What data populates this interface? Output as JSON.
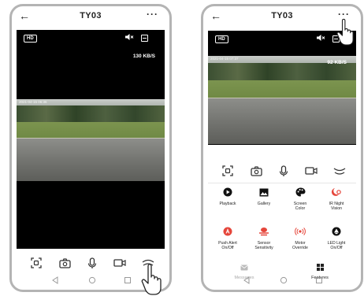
{
  "phones": [
    {
      "title": "TY03",
      "back_icon": "arrow-left-icon",
      "more_icon": "more-dots-icon",
      "video": {
        "quality_badge": "HD",
        "speed": "130 KB/S",
        "timestamp": "2021-04-15 06:36"
      },
      "controls": [
        "screenshot-icon",
        "camera-icon",
        "microphone-icon",
        "video-record-icon",
        "expand-icon"
      ]
    },
    {
      "title": "TY03",
      "back_icon": "arrow-left-icon",
      "more_icon": "more-dots-icon",
      "video": {
        "quality_badge": "HD",
        "speed": "92 KB/S",
        "timestamp": "2021-04-15 07:37"
      },
      "controls": [
        "screenshot-icon",
        "camera-icon",
        "microphone-icon",
        "video-record-icon",
        "expand-icon"
      ],
      "features": [
        {
          "label": "Playback",
          "icon": "play-icon",
          "color": "#111111"
        },
        {
          "label": "Gallery",
          "icon": "gallery-icon",
          "color": "#111111"
        },
        {
          "label": "Screen\nColor",
          "icon": "palette-icon",
          "color": "#111111"
        },
        {
          "label": "IR Night\nVision",
          "icon": "night-vision-icon",
          "color": "#e5463b"
        },
        {
          "label": "Push Alert\nOn/Off",
          "icon": "alert-icon",
          "color": "#e5463b"
        },
        {
          "label": "Sensor\nSensitivity",
          "icon": "sensor-icon",
          "color": "#e5463b"
        },
        {
          "label": "Motor\nOverride",
          "icon": "motor-icon",
          "color": "#e5463b"
        },
        {
          "label": "LED Light\nOn/Off",
          "icon": "light-icon",
          "color": "#111111"
        }
      ],
      "bottom_tabs": [
        {
          "label": "Messages",
          "icon": "message-icon",
          "active": false
        },
        {
          "label": "Features",
          "icon": "features-grid-icon",
          "active": true
        }
      ]
    }
  ],
  "navbar": [
    "nav-back-icon",
    "nav-home-icon",
    "nav-recents-icon"
  ],
  "colors": {
    "accent_red": "#e5463b",
    "frame": "#b4b4b4"
  }
}
